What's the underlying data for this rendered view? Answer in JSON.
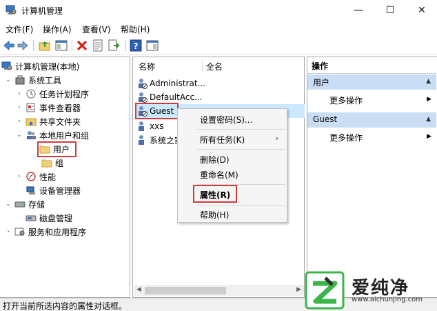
{
  "window": {
    "title": "计算机管理",
    "min": "—",
    "max": "☐",
    "close": "✕"
  },
  "menu": [
    "文件(F)",
    "操作(A)",
    "查看(V)",
    "帮助(H)"
  ],
  "tree": {
    "root": "计算机管理(本地)",
    "system_tools": "系统工具",
    "task_scheduler": "任务计划程序",
    "event_viewer": "事件查看器",
    "shared_folders": "共享文件夹",
    "local_users_groups": "本地用户和组",
    "users": "用户",
    "groups": "组",
    "performance": "性能",
    "device_manager": "设备管理器",
    "storage": "存储",
    "disk_management": "磁盘管理",
    "services_apps": "服务和应用程序"
  },
  "list": {
    "col_name": "名称",
    "col_fullname": "全名",
    "rows": [
      "Administrat...",
      "DefaultAcc...",
      "Guest",
      "xxs",
      "系统之家"
    ]
  },
  "context_menu": {
    "set_password": "设置密码(S)...",
    "all_tasks": "所有任务(K)",
    "delete": "删除(D)",
    "rename": "重命名(M)",
    "properties": "属性(R)",
    "help": "帮助(H)"
  },
  "actions": {
    "header": "操作",
    "section1": "用户",
    "section1_more": "更多操作",
    "section2": "Guest",
    "section2_more": "更多操作"
  },
  "status": "打开当前所选内容的属性对话框。",
  "watermark": {
    "brand": "爱纯净",
    "url": "www.aichunjing.com"
  },
  "colors": {
    "selection": "#cce8ff",
    "highlight_box": "#d43a3a",
    "action_section": "#c9ddf4",
    "logo_green": "#3cb54a"
  }
}
